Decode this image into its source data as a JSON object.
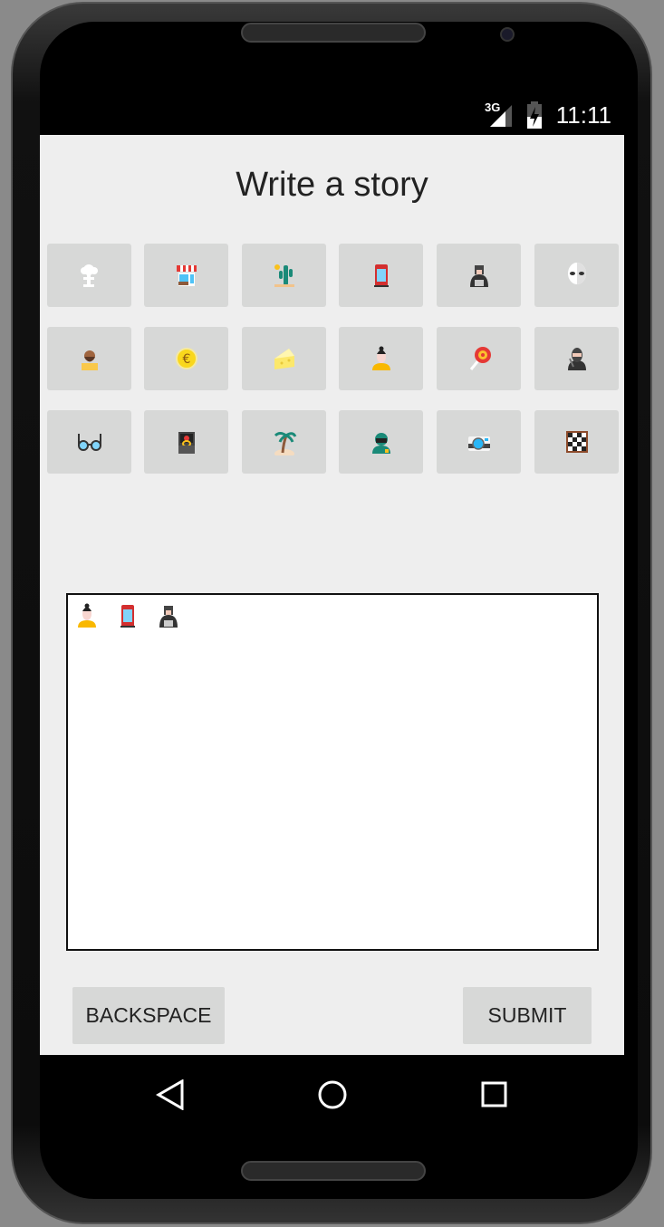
{
  "status_bar": {
    "network": "3G",
    "time": "11:11"
  },
  "title": "Write a story",
  "tiles": [
    "mushroom-cloud",
    "shop",
    "cactus",
    "phone-booth",
    "batman",
    "alien",
    "bearded-man",
    "euro-coin",
    "cheese",
    "woman",
    "lollipop",
    "ninja",
    "glasses",
    "ring-box",
    "palm-island",
    "soldier",
    "camera",
    "chessboard"
  ],
  "story": [
    "woman",
    "phone-booth",
    "batman"
  ],
  "buttons": {
    "backspace": "BACKSPACE",
    "submit": "SUBMIT"
  },
  "nav": {
    "back": "back",
    "home": "home",
    "recents": "recents"
  }
}
